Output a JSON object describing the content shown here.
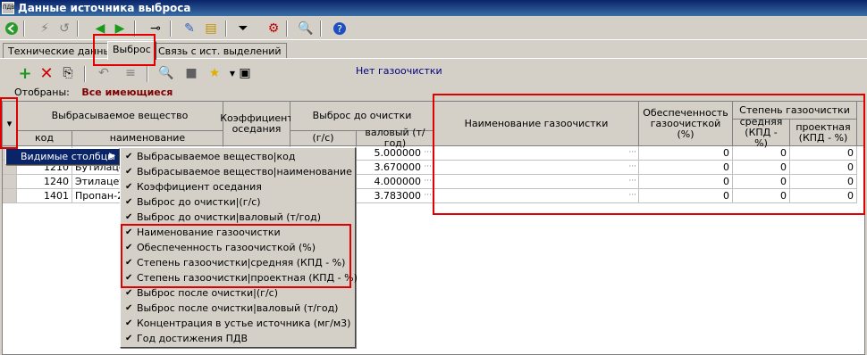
{
  "window": {
    "title": "Данные источника выброса",
    "app_icon": "ПДВ"
  },
  "tabs": [
    {
      "label": "Технические данные"
    },
    {
      "label": "Выброс"
    },
    {
      "label": "Связь с ист. выделений"
    }
  ],
  "status_text": "Нет газоочистки",
  "filter": {
    "label": "Отобраны:",
    "value": "Все имеющиеся"
  },
  "columns": {
    "substance": "Выбрасываемое вещество",
    "code": "код",
    "name": "наименование",
    "coef": "Коэффициент оседания",
    "emission_before": "Выброс до очистки",
    "gs": "(г/с)",
    "annual": "валовый (т/год)",
    "cleaner_name": "Наименование газоочистки",
    "provision": "Обеспеченность газоочисткой (%)",
    "degree": "Степень газоочистки",
    "avg": "средняя (КПД - %)",
    "design": "проектная (КПД - %)"
  },
  "rows": [
    {
      "code": "",
      "name": "",
      "annual": "5.000000",
      "provision": "0",
      "avg": "0",
      "design": "0"
    },
    {
      "code": "1210",
      "name": "Бутилацет",
      "annual": "3.670000",
      "provision": "0",
      "avg": "0",
      "design": "0"
    },
    {
      "code": "1240",
      "name": "Этилацета",
      "annual": "4.000000",
      "provision": "0",
      "avg": "0",
      "design": "0"
    },
    {
      "code": "1401",
      "name": "Пропан-2-",
      "annual": "3.783000",
      "provision": "0",
      "avg": "0",
      "design": "0"
    }
  ],
  "context_menu": {
    "visible_columns": "Видимые столбцы"
  },
  "submenu": [
    {
      "label": "Выбрасываемое вещество|код",
      "checked": true
    },
    {
      "label": "Выбрасываемое вещество|наименование",
      "checked": true
    },
    {
      "label": "Коэффициент оседания",
      "checked": true
    },
    {
      "label": "Выброс до очистки|(г/с)",
      "checked": true
    },
    {
      "label": "Выброс до очистки|валовый (т/год)",
      "checked": true
    },
    {
      "label": "Наименование газоочистки",
      "checked": true
    },
    {
      "label": "Обеспеченность газоочисткой (%)",
      "checked": true
    },
    {
      "label": "Степень газоочистки|средняя  (КПД - %)",
      "checked": true
    },
    {
      "label": "Степень газоочистки|проектная (КПД - %)",
      "checked": true
    },
    {
      "label": "Выброс после очистки|(г/с)",
      "checked": true
    },
    {
      "label": "Выброс после очистки|валовый (т/год)",
      "checked": true
    },
    {
      "label": "Концентрация в устье источника (мг/м3)",
      "checked": true
    },
    {
      "label": "Год достижения ПДВ",
      "checked": true
    }
  ],
  "colors": {
    "highlight": "#e00000",
    "menu_selected": "#0a246a",
    "filter_value": "#800000",
    "status_text": "#000080"
  }
}
